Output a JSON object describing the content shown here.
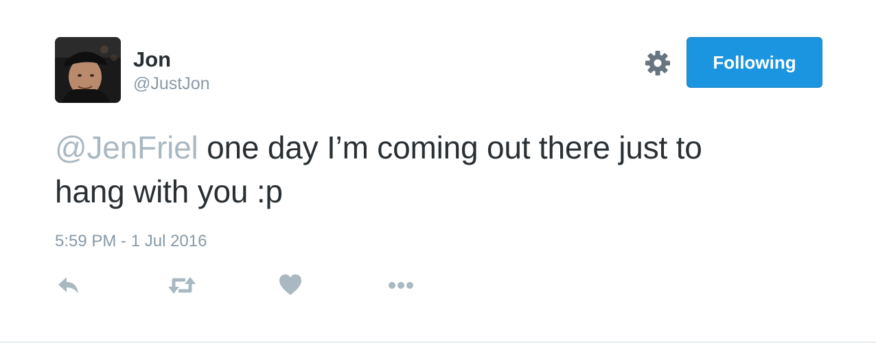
{
  "author": {
    "display_name": "Jon",
    "handle": "@JustJon"
  },
  "header": {
    "settings_icon": "gear-icon",
    "follow_label": "Following",
    "follow_color": "#1b95e0"
  },
  "tweet": {
    "mention": "@JenFriel",
    "text_line1": " one day I’m coming out there just to",
    "text_line2": "hang with you :p",
    "timestamp": "5:59 PM - 1 Jul 2016"
  },
  "actions": [
    {
      "icon": "reply-icon"
    },
    {
      "icon": "retweet-icon"
    },
    {
      "icon": "heart-icon"
    },
    {
      "icon": "more-icon"
    }
  ],
  "colors": {
    "text": "#292f33",
    "muted": "#8899a6",
    "mention": "#aab8c2",
    "icon": "#aab8c2"
  }
}
